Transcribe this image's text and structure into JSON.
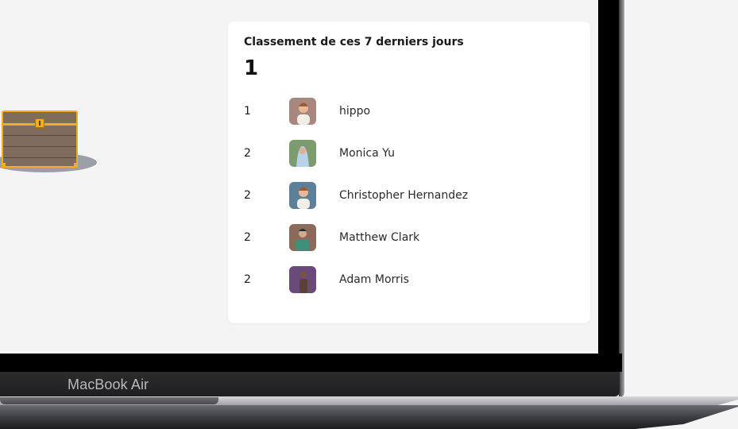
{
  "leaderboard": {
    "title": "Classement de ces 7 derniers jours",
    "current_rank": "1",
    "rows": [
      {
        "rank": "1",
        "name": "hippo",
        "avatar_color": "#a8877e"
      },
      {
        "rank": "2",
        "name": "Monica Yu",
        "avatar_color": "#7d9b6e"
      },
      {
        "rank": "2",
        "name": "Christopher Hernandez",
        "avatar_color": "#5d7f98"
      },
      {
        "rank": "2",
        "name": "Matthew Clark",
        "avatar_color": "#8a6a58"
      },
      {
        "rank": "2",
        "name": "Adam Morris",
        "avatar_color": "#6a4a78"
      }
    ]
  },
  "device": {
    "label": "MacBook Air"
  },
  "colors": {
    "chest_trim": "#f3ae20",
    "chest_wood": "#806c5c",
    "background": "#f4f4f4"
  }
}
